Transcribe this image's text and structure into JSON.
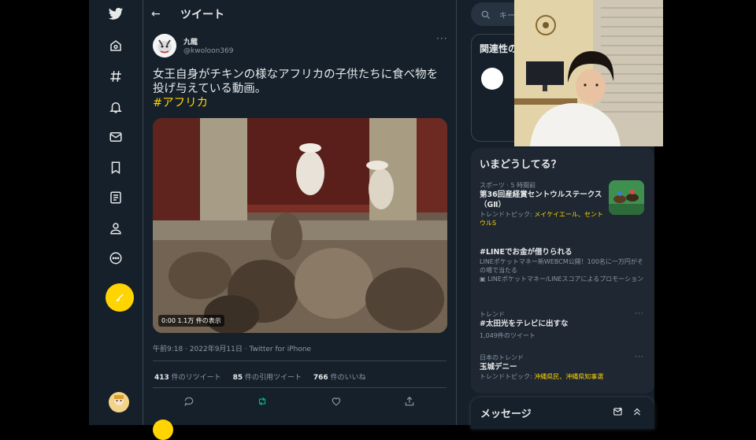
{
  "header": {
    "title": "ツイート"
  },
  "tweet": {
    "author_name": "九龍",
    "author_handle": "@kwoloon369",
    "text": "女王自身がチキンの様なアフリカの子供たちに食べ物を投げ与えている動画。",
    "hashtag": "#アフリカ",
    "video_label": "0:00  1.1万 件の表示",
    "meta": "午前9:18 · 2022年9月11日 · Twitter for iPhone",
    "stats": {
      "retweets_num": "413",
      "retweets_label": "件のリツイート",
      "quotes_num": "85",
      "quotes_label": "件の引用ツイート",
      "likes_num": "766",
      "likes_label": "件のいいね"
    }
  },
  "search": {
    "placeholder": "キー"
  },
  "relevant": {
    "title": "関連性の"
  },
  "trends": {
    "title": "いまどうしてる？",
    "items": [
      {
        "meta": "スポーツ · 5 時間前",
        "name": "第36回産経賞セントウルステークス（GⅡ）",
        "sub_prefix": "トレンドトピック: ",
        "sub_highlight": "メイケイエール、セントウルS"
      },
      {
        "meta": "",
        "name": "#LINEでお金が借りられる",
        "sub_prefix": "LINEポケットマネー新WEBCM公開！100名に一万円がその場で当たる",
        "sub_highlight": "",
        "promo": "LINEポケットマネー/LINEスコアによるプロモーション"
      },
      {
        "meta": "トレンド",
        "name": "#太田光をテレビに出すな",
        "sub_prefix": "1,049件のツイート",
        "sub_highlight": ""
      },
      {
        "meta": "日本のトレンド",
        "name": "玉城デニー",
        "sub_prefix": "トレンドトピック: ",
        "sub_highlight": "沖縄県民、沖縄県知事選"
      }
    ]
  },
  "messages": {
    "title": "メッセージ"
  },
  "icons": {
    "brand": "twitter-bird-icon",
    "accent": "#ffd400",
    "background": "#15202b"
  }
}
